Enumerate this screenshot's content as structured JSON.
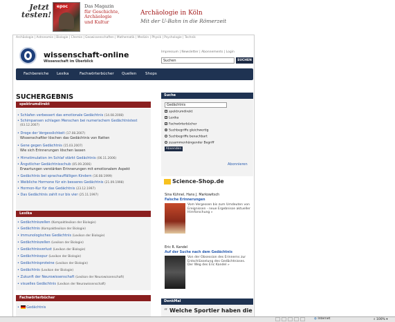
{
  "banner": {
    "jetzt": "Jetzt testen!",
    "cover_label": "epoc",
    "magazin_line1": "Das Magazin",
    "magazin_line2": "für Geschichte,",
    "magazin_line3": "Archäologie",
    "magazin_line4": "und Kultur",
    "title": "Archäologie in Köln",
    "subtitle": "Mit der U-Bahn in die Römerzeit"
  },
  "topnav": "Archäologie | Astronomie | Biologie | Chemie | Geowissenschaften | Mathematik | Medizin | Physik | Psychologie | Technik",
  "site": {
    "name": "wissenschaft-online",
    "tagline": "Wissenschaft im Überblick",
    "util_links": "Impressum | Newsletter | Abonnements | Login",
    "search_value": "Suchen",
    "search_button": "SUCHEN"
  },
  "mainnav": [
    "Fachbereiche",
    "Lexika",
    "Fachwörterbücher",
    "Quellen",
    "Shops"
  ],
  "results_title": "SUCHERGEBNIS",
  "spektrumdirekt": {
    "heading": "spektrumdirekt",
    "items": [
      {
        "title": "Schlafen verbessert das emotionale Gedächtnis",
        "date": "(14.08.2008)",
        "sub": ""
      },
      {
        "title": "Schimpansen schlagen Menschen bei numerischem Gedächtnistest",
        "date": "(03.12.2007)",
        "sub": ""
      },
      {
        "title": "Droge der Vergesslichkeit",
        "date": "(17.08.2007)",
        "sub": "Wissenschaftler löschen das Gedächtnis von Ratten"
      },
      {
        "title": "Gene gegen Gedächtnis",
        "date": "(15.03.2007)",
        "sub": "Wie sich Erinnerungen löschen lassen"
      },
      {
        "title": "Hirnstimulation im Schlaf stärkt Gedächtnis",
        "date": "(06.11.2006)",
        "sub": ""
      },
      {
        "title": "Ängstlicher Gedächtnisschub",
        "date": "(05.09.2006)",
        "sub": "Erwartungen verstärken Erinnerungen mit emotionalem Aspekt"
      },
      {
        "title": "Gedächtnis bei sprachauffälligen Kindern",
        "date": "(16.08.1999)",
        "sub": ""
      },
      {
        "title": "Weibliche Hormone für ein besseres Gedächtnis",
        "date": "(21.09.1998)",
        "sub": ""
      },
      {
        "title": "Hormon-Kur für das Gedächtnis",
        "date": "(23.12.1997)",
        "sub": ""
      },
      {
        "title": "Das Gedächtnis zahlt nur bis vier",
        "date": "(25.11.1997)",
        "sub": ""
      }
    ]
  },
  "lexika": {
    "heading": "Lexika",
    "items": [
      {
        "title": "Gedächtniszellen",
        "src": "(Kompaktlexikon der Biologie)"
      },
      {
        "title": "Gedächtnis",
        "src": "(Kompaktlexikon der Biologie)"
      },
      {
        "title": "immunologisches Gedächtnis",
        "src": "(Lexikon der Biologie)"
      },
      {
        "title": "Gedächtniszellen",
        "src": "(Lexikon der Biologie)"
      },
      {
        "title": "Gedächtnisverlust",
        "src": "(Lexikon der Biologie)"
      },
      {
        "title": "Gedächtnisspur",
        "src": "(Lexikon der Biologie)"
      },
      {
        "title": "Gedächtnisproteine",
        "src": "(Lexikon der Biologie)"
      },
      {
        "title": "Gedächtnis",
        "src": "(Lexikon der Biologie)"
      },
      {
        "title": "Zukunft der Neurowissenschaft",
        "src": "(Lexikon der Neurowissenschaft)"
      },
      {
        "title": "visuelles Gedächtnis",
        "src": "(Lexikon der Neurowissenschaft)"
      }
    ]
  },
  "fachwoerterbuecher": {
    "heading": "Fachwörterbücher",
    "items": [
      "Gedächtnis"
    ]
  },
  "suche_panel": {
    "heading": "Suche",
    "value": "Gedächtnis",
    "checks": [
      "spektrumdirekt",
      "Lexika",
      "Fachwörterbücher"
    ],
    "radios": [
      {
        "label": "Suchbegriffe gleichwertig",
        "checked": true
      },
      {
        "label": "Suchbegriffe benachbart",
        "checked": false
      },
      {
        "label": "zusammenhängender Begriff",
        "checked": false
      }
    ],
    "submit": "Absenden",
    "abonnieren": "Abonnieren"
  },
  "shop": {
    "logo": "Science-Shop.de",
    "books": [
      {
        "author": "Sina Kühnel, Hans J. Markowitsch",
        "title": "Falsche Erinnerungen",
        "desc": "Vom Vergessen bis zum Umdeuten von Ereignissen - neue Ergebnisse aktueller Hirnforschung »"
      },
      {
        "author": "Eric R. Kandel",
        "title": "Auf der Suche nach dem Gedächtnis",
        "desc": "Von der Obsession des Erinnerns zur Entschlüsselung des Gedächtnisses. Der Weg des Eric Kandel »"
      }
    ]
  },
  "denkmal": {
    "heading": "DenkMal",
    "teaser": "Welche Sportler haben die"
  },
  "statusbar": {
    "zone": "Internet",
    "zoom": "100%"
  },
  "colors": {
    "nav_bg": "#1f3352",
    "section_red": "#8a1f1f",
    "link_blue": "#2a5db0",
    "ad_red": "#a31a1a"
  }
}
